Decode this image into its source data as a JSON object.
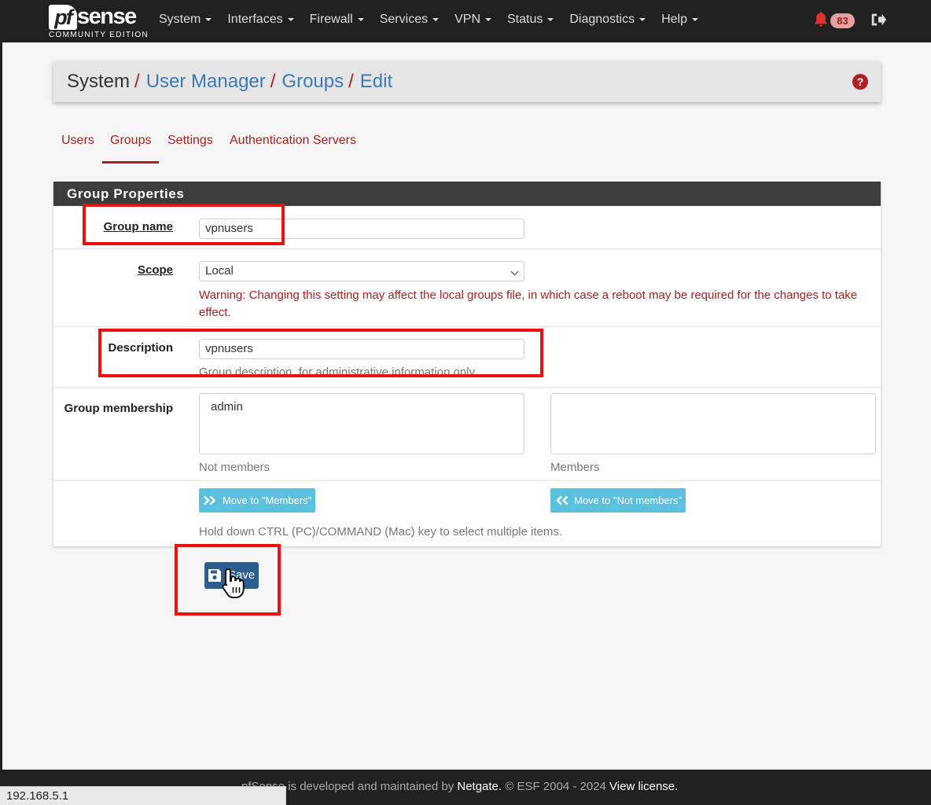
{
  "brand": {
    "logo_pf": "pf",
    "logo_sense": "sense",
    "edition": "COMMUNITY EDITION"
  },
  "nav": {
    "items": [
      "System",
      "Interfaces",
      "Firewall",
      "Services",
      "VPN",
      "Status",
      "Diagnostics",
      "Help"
    ],
    "notification_count": "83",
    "icons": {
      "notifications": "bell-icon",
      "logout": "sign-out-icon"
    }
  },
  "breadcrumb": {
    "root": "System",
    "sep": "/",
    "items": [
      "User Manager",
      "Groups",
      "Edit"
    ],
    "help_icon": "?"
  },
  "tabs": [
    "Users",
    "Groups",
    "Settings",
    "Authentication Servers"
  ],
  "active_tab": "Groups",
  "panel": {
    "title": "Group Properties",
    "group_name": {
      "label": "Group name",
      "value": "vpnusers"
    },
    "scope": {
      "label": "Scope",
      "value": "Local",
      "warning": "Warning: Changing this setting may affect the local groups file, in which case a reboot may be required for the changes to take effect."
    },
    "description": {
      "label": "Description",
      "value": "vpnusers",
      "help": "Group description, for administrative information only"
    },
    "membership": {
      "label": "Group membership",
      "not_members": [
        "admin"
      ],
      "not_members_label": "Not members",
      "members": [],
      "members_label": "Members",
      "move_to_members": "Move to \"Members\"",
      "move_to_not_members": "Move to \"Not members\"",
      "hint": "Hold down CTRL (PC)/COMMAND (Mac) key to select multiple items."
    }
  },
  "save_label": "Save",
  "footer": {
    "prefix": "pfSense is developed and maintained by ",
    "company": "Netgate.",
    "copyright": " © ESF 2004 - 2024 ",
    "license": "View license."
  },
  "status_url": "192.168.5.1",
  "colors": {
    "accent": "#a7221e",
    "link": "#3b7ab8",
    "navbar": "#212121",
    "annotation": "#ee0f0f",
    "primary": "#2d5d8f",
    "info": "#5bc0de"
  }
}
